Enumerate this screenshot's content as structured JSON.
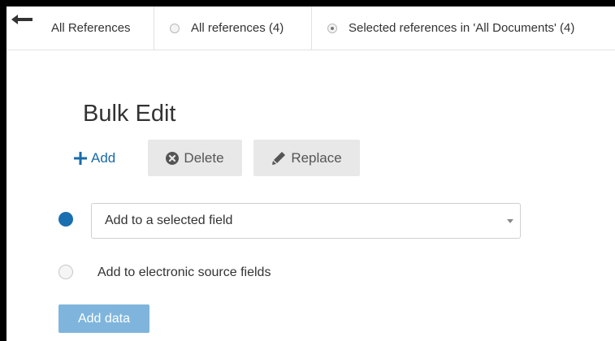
{
  "header": {
    "all_references_tab": "All References",
    "scope_options": [
      {
        "label": "All references (4)",
        "selected": false
      },
      {
        "label": "Selected references in 'All Documents' (4)",
        "selected": true
      }
    ]
  },
  "bulk_edit": {
    "title": "Bulk Edit",
    "actions": {
      "add_label": "Add",
      "delete_label": "Delete",
      "replace_label": "Replace"
    },
    "field_selector": {
      "selected_value": "Add to a selected field",
      "selected": true
    },
    "electronic_option": {
      "label": "Add to electronic source fields",
      "selected": false
    },
    "submit_label": "Add data"
  },
  "colors": {
    "accent": "#1a6fb0",
    "link": "#1a6aa8",
    "button_grey": "#e8e8e8",
    "disabled_primary": "#7fb5dc"
  }
}
